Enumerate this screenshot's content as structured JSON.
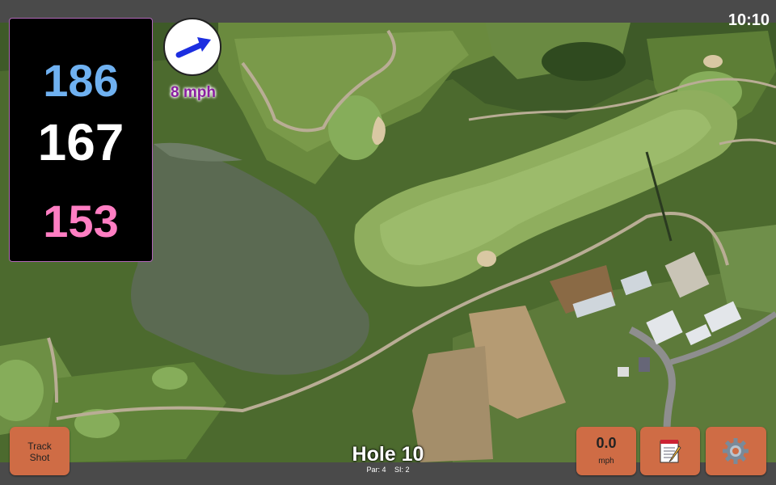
{
  "status_bar": {
    "time": "10:10"
  },
  "distances": {
    "back": "186",
    "middle": "167",
    "front": "153"
  },
  "wind": {
    "speed": "8 mph",
    "icon": "wind-arrow-icon"
  },
  "hole": {
    "title": "Hole 10",
    "par": "Par: 4",
    "si": "SI: 2"
  },
  "buttons": {
    "track_shot_line1": "Track",
    "track_shot_line2": "Shot",
    "speed_value": "0.0",
    "speed_unit": "mph",
    "notes_icon": "notepad-icon",
    "settings_icon": "gear-icon"
  },
  "colors": {
    "back": "#6fb1f1",
    "middle": "#ffffff",
    "front": "#ff7ec3",
    "button": "#cf6c45",
    "wind_text": "#8a1fa0"
  }
}
